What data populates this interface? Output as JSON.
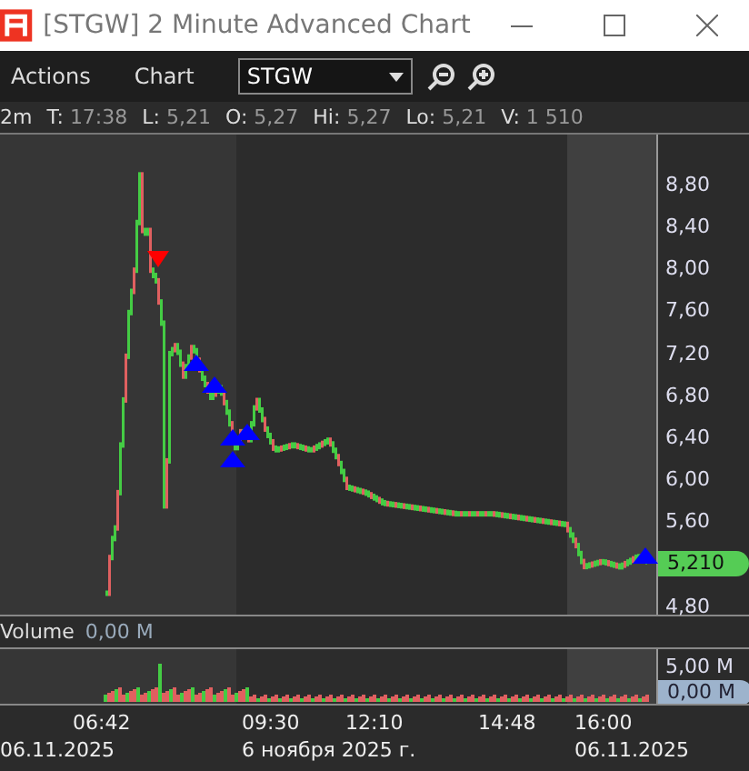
{
  "window": {
    "title": "[STGW] 2 Minute Advanced Chart"
  },
  "menu": [
    "Actions",
    "Chart"
  ],
  "symbol_dropdown": {
    "value": "STGW"
  },
  "info_bar": {
    "interval": "2m",
    "fields": [
      {
        "label": "T:",
        "value": "17:38"
      },
      {
        "label": "L:",
        "value": "5,21"
      },
      {
        "label": "O:",
        "value": "5,27"
      },
      {
        "label": "Hi:",
        "value": "5,27"
      },
      {
        "label": "Lo:",
        "value": "5,21"
      },
      {
        "label": "V:",
        "value": "1 510"
      }
    ]
  },
  "price_axis": {
    "ticks": [
      "8,80",
      "8,40",
      "8,00",
      "7,60",
      "7,20",
      "6,80",
      "6,40",
      "6,00",
      "5,60",
      "4,80"
    ],
    "last_price": "5,210"
  },
  "volume": {
    "label": "Volume",
    "value": "0,00 M",
    "axis_ticks": [
      "5,00 M"
    ],
    "last_value": "0,00 M"
  },
  "time_axis": {
    "times": [
      "06:42",
      "09:30",
      "12:10",
      "14:48",
      "16:00"
    ],
    "dates": [
      "06.11.2025",
      "6 ноября 2025 г.",
      "06.11.2025"
    ]
  }
}
